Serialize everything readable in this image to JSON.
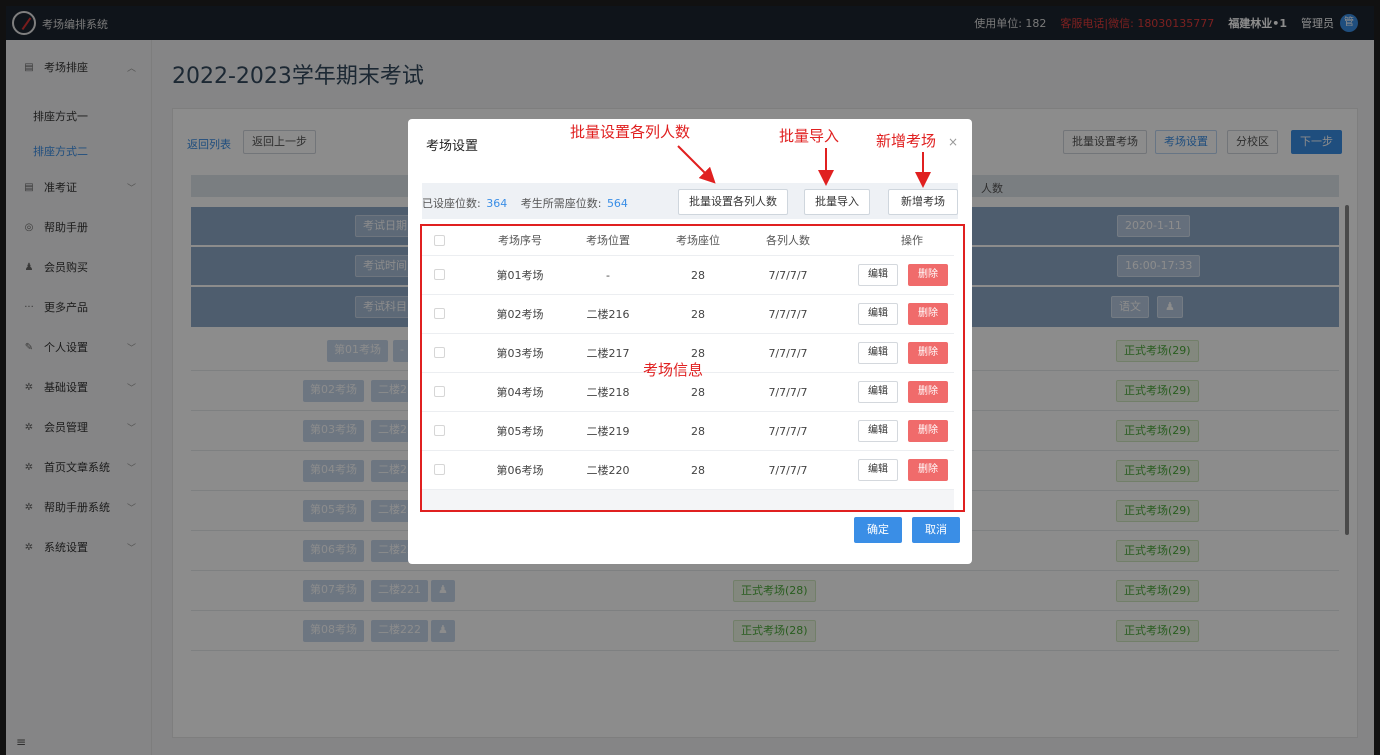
{
  "app": {
    "title": "考场编排系统",
    "unit_label": "使用单位: 182",
    "hotline": "客服电话|微信: 18030135777",
    "company": "福建林业•1",
    "admin": "管理员",
    "avatar_text": "管"
  },
  "sidebar": {
    "items": [
      {
        "label": "考场排座",
        "icon": "grid-icon"
      },
      {
        "label": "准考证",
        "icon": "grid-icon"
      },
      {
        "label": "帮助手册",
        "icon": "circle-icon"
      },
      {
        "label": "会员购买",
        "icon": "user-icon"
      },
      {
        "label": "更多产品",
        "icon": "dots-icon"
      },
      {
        "label": "个人设置",
        "icon": "edit-icon"
      },
      {
        "label": "基础设置",
        "icon": "gear-icon"
      },
      {
        "label": "会员管理",
        "icon": "gear-icon"
      },
      {
        "label": "首页文章系统",
        "icon": "gear-icon"
      },
      {
        "label": "帮助手册系统",
        "icon": "gear-icon"
      },
      {
        "label": "系统设置",
        "icon": "gear-icon"
      }
    ],
    "sub_items": [
      "排座方式一",
      "排座方式二"
    ],
    "menu_icon": "≡"
  },
  "page": {
    "title": "2022-2023学年期末考试",
    "back_list": "返回列表",
    "back_prev": "返回上一步",
    "toolbar": {
      "batch_room": "批量设置考场",
      "room_settings": "考场设置",
      "branch": "分校区",
      "next": "下一步"
    },
    "header_partial": "人数",
    "band_labels": [
      "考试日期",
      "考试时间",
      "考试科目"
    ],
    "band_values": [
      "2020-1-11",
      "16:00-17:33",
      "语文"
    ],
    "rows": [
      {
        "room": "第01考场",
        "loc": "-",
        "mid": "",
        "right": "正式考场(29)"
      },
      {
        "room": "第02考场",
        "loc": "二楼21",
        "mid": "",
        "right": "正式考场(29)"
      },
      {
        "room": "第03考场",
        "loc": "二楼21",
        "mid": "",
        "right": "正式考场(29)"
      },
      {
        "room": "第04考场",
        "loc": "二楼21",
        "mid": "",
        "right": "正式考场(29)"
      },
      {
        "room": "第05考场",
        "loc": "二楼21",
        "mid": "",
        "right": "正式考场(29)"
      },
      {
        "room": "第06考场",
        "loc": "二楼22",
        "mid": "",
        "right": "正式考场(29)"
      },
      {
        "room": "第07考场",
        "loc": "二楼221",
        "mid": "正式考场(28)",
        "right": "正式考场(29)"
      },
      {
        "room": "第08考场",
        "loc": "二楼222",
        "mid": "正式考场(28)",
        "right": "正式考场(29)"
      }
    ]
  },
  "modal": {
    "title": "考场设置",
    "close": "×",
    "set_seats_label": "已设座位数:",
    "set_seats": "364",
    "need_seats_label": "考生所需座位数:",
    "need_seats": "564",
    "btn_batch_cols": "批量设置各列人数",
    "btn_import": "批量导入",
    "btn_add": "新增考场",
    "columns": [
      "考场序号",
      "考场位置",
      "考场座位",
      "各列人数",
      "操作"
    ],
    "rows": [
      {
        "no": "第01考场",
        "loc": "-",
        "seats": "28",
        "cols": "7/7/7/7"
      },
      {
        "no": "第02考场",
        "loc": "二楼216",
        "seats": "28",
        "cols": "7/7/7/7"
      },
      {
        "no": "第03考场",
        "loc": "二楼217",
        "seats": "28",
        "cols": "7/7/7/7"
      },
      {
        "no": "第04考场",
        "loc": "二楼218",
        "seats": "28",
        "cols": "7/7/7/7"
      },
      {
        "no": "第05考场",
        "loc": "二楼219",
        "seats": "28",
        "cols": "7/7/7/7"
      },
      {
        "no": "第06考场",
        "loc": "二楼220",
        "seats": "28",
        "cols": "7/7/7/7"
      }
    ],
    "edit": "编辑",
    "delete": "删除",
    "ok": "确定",
    "cancel": "取消"
  },
  "annotations": {
    "batch_cols": "批量设置各列人数",
    "import": "批量导入",
    "add_room": "新增考场",
    "room_info": "考场信息"
  },
  "colors": {
    "accent": "#3a8ee6",
    "danger": "#f06b6b",
    "annotation": "#e02020"
  }
}
